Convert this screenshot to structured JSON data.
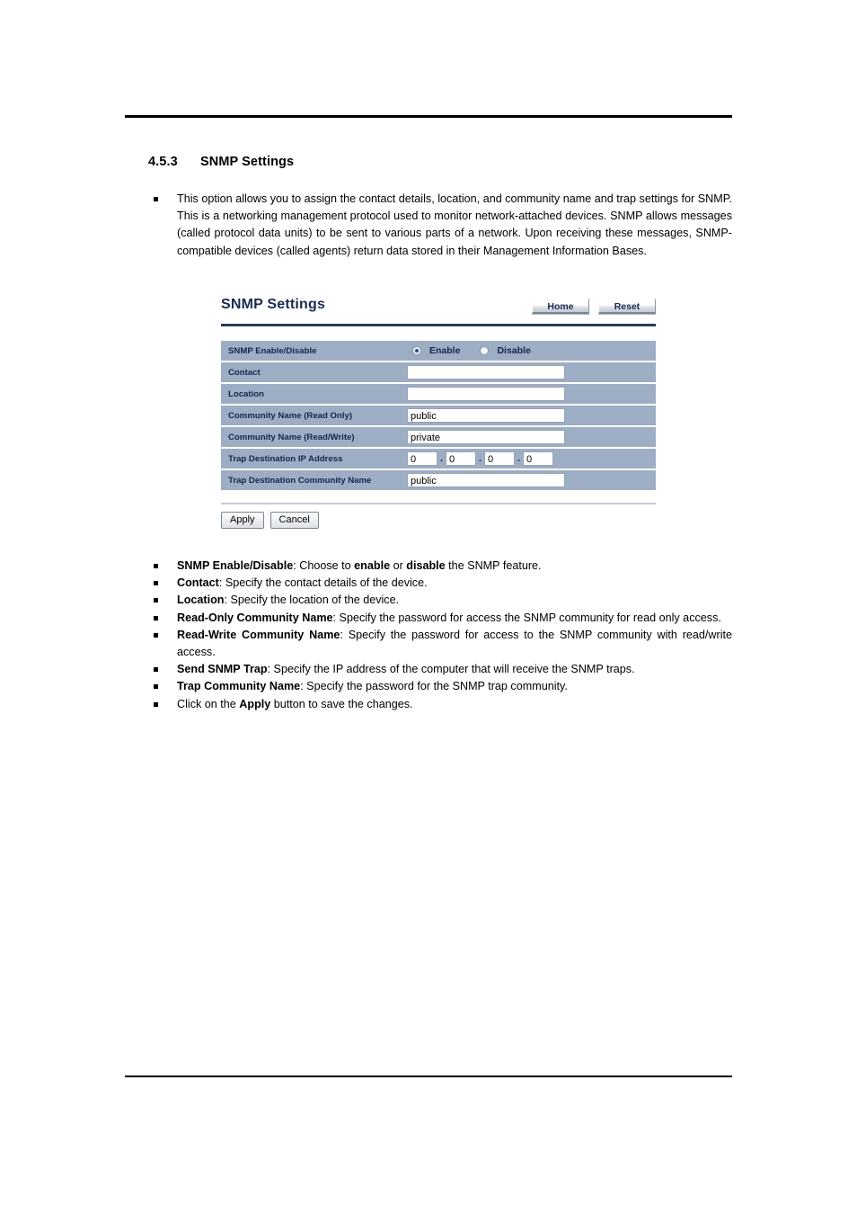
{
  "section": {
    "number": "4.5.3",
    "title": "SNMP Settings"
  },
  "intro": {
    "text": "This option allows you to assign the contact details, location, and community name and trap settings for SNMP. This is a networking management protocol used to monitor network-attached devices. SNMP allows messages (called protocol data units) to be sent to various parts of a network. Upon receiving these messages, SNMP-compatible devices (called agents) return data stored in their Management Information Bases."
  },
  "ui": {
    "title": "SNMP Settings",
    "home_label": "Home",
    "reset_label": "Reset",
    "apply_label": "Apply",
    "cancel_label": "Cancel",
    "rows": {
      "enable_label": "SNMP Enable/Disable",
      "enable_option": "Enable",
      "disable_option": "Disable",
      "contact_label": "Contact",
      "contact_value": "",
      "location_label": "Location",
      "location_value": "",
      "read_only_label": "Community Name (Read Only)",
      "read_only_value": "public",
      "read_write_label": "Community Name (Read/Write)",
      "read_write_value": "private",
      "trap_ip_label": "Trap Destination IP Address",
      "trap_ip_octet1": "0",
      "trap_ip_octet2": "0",
      "trap_ip_octet3": "0",
      "trap_ip_octet4": "0",
      "trap_community_label": "Trap Destination Community Name",
      "trap_community_value": "public"
    },
    "selected_radio": "Enable",
    "colors": {
      "row_bg": "#9dadc4",
      "label_text": "#15254c",
      "title_text": "#1b2a52",
      "radio_dot": "#1a4fa0"
    }
  },
  "descriptions": [
    {
      "term": "SNMP Enable/Disable",
      "parts": [
        {
          "text": ": Choose to ",
          "bold": false
        },
        {
          "text": "enable",
          "bold": true
        },
        {
          "text": " or ",
          "bold": false
        },
        {
          "text": "disable",
          "bold": true
        },
        {
          "text": " the SNMP feature.",
          "bold": false
        }
      ]
    },
    {
      "term": "Contact",
      "parts": [
        {
          "text": ": Specify the contact details of the device.",
          "bold": false
        }
      ]
    },
    {
      "term": "Location",
      "parts": [
        {
          "text": ": Specify the location of the device.",
          "bold": false
        }
      ]
    },
    {
      "term": "Read-Only Community Name",
      "parts": [
        {
          "text": ": Specify the password for access the SNMP community for read only access.",
          "bold": false
        }
      ]
    },
    {
      "term": "Read-Write Community Name",
      "parts": [
        {
          "text": ": Specify the password for access to the SNMP community with read/write access.",
          "bold": false
        }
      ]
    },
    {
      "term": "Send SNMP Trap",
      "parts": [
        {
          "text": ": Specify the IP address of the computer that will receive the SNMP traps.",
          "bold": false
        }
      ]
    },
    {
      "term": "Trap Community Name",
      "parts": [
        {
          "text": ": Specify the password for the SNMP trap community.",
          "bold": false
        }
      ]
    },
    {
      "term": "",
      "parts": [
        {
          "text": "Click on the ",
          "bold": false
        },
        {
          "text": "Apply",
          "bold": true
        },
        {
          "text": " button to save the changes.",
          "bold": false
        }
      ]
    }
  ]
}
